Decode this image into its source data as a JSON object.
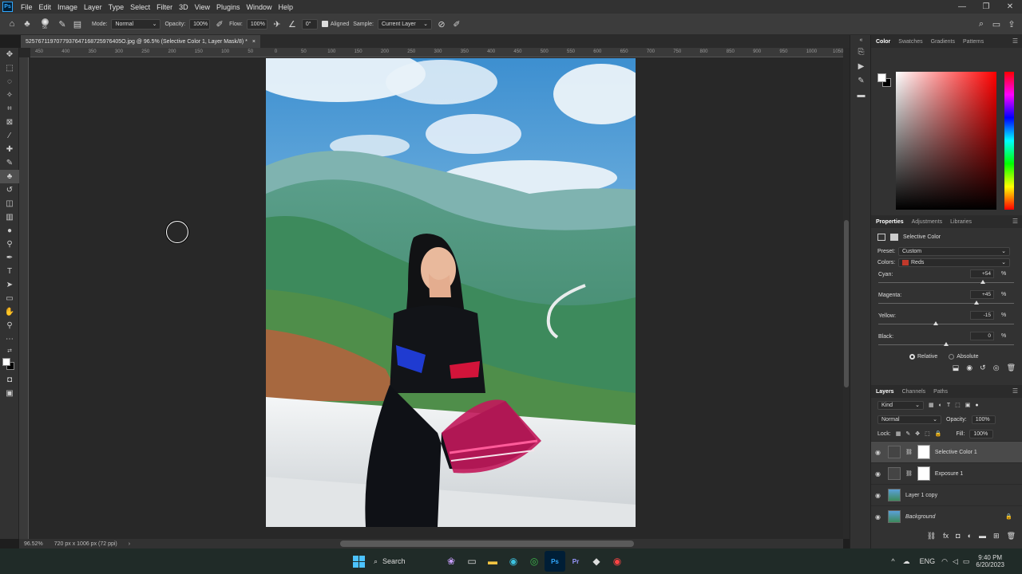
{
  "menu": {
    "logo": "Ps",
    "items": [
      "File",
      "Edit",
      "Image",
      "Layer",
      "Type",
      "Select",
      "Filter",
      "3D",
      "View",
      "Plugins",
      "Window",
      "Help"
    ]
  },
  "options_bar": {
    "brush_size": "56",
    "mode_label": "Mode:",
    "mode_value": "Normal",
    "opacity_label": "Opacity:",
    "opacity_value": "100%",
    "flow_label": "Flow:",
    "flow_value": "100%",
    "angle_value": "0°",
    "aligned_label": "Aligned",
    "sample_label": "Sample:",
    "sample_value": "Current Layer"
  },
  "document": {
    "tab_title": "5257671197077937647168725976405O.jpg @ 96.5% (Selective Color 1, Layer Mask/8) *",
    "close": "×"
  },
  "rulers": {
    "top": [
      "450",
      "400",
      "350",
      "300",
      "250",
      "200",
      "150",
      "100",
      "50",
      "0",
      "50",
      "100",
      "150",
      "200",
      "250",
      "300",
      "350",
      "400",
      "450",
      "500",
      "550",
      "600",
      "650",
      "700",
      "750",
      "800",
      "850",
      "900",
      "950",
      "1000",
      "1050"
    ]
  },
  "status": {
    "zoom": "96.52%",
    "doc_size": "720 px x 1006 px (72 ppi)",
    "arrow": "›"
  },
  "color_panel": {
    "tabs": [
      "Color",
      "Swatches",
      "Gradients",
      "Patterns"
    ],
    "active": "Color",
    "accent": "#ff0000"
  },
  "properties": {
    "tabs": [
      "Properties",
      "Adjustments",
      "Libraries"
    ],
    "title": "Selective Color",
    "preset_label": "Preset:",
    "preset_value": "Custom",
    "colors_label": "Colors:",
    "colors_value": "Reds",
    "sliders": [
      {
        "label": "Cyan:",
        "value": "+54",
        "fraction": 0.77
      },
      {
        "label": "Magenta:",
        "value": "+45",
        "fraction": 0.725
      },
      {
        "label": "Yellow:",
        "value": "-15",
        "fraction": 0.425
      },
      {
        "label": "Black:",
        "value": "0",
        "fraction": 0.5
      }
    ],
    "pct": "%",
    "relative_label": "Relative",
    "absolute_label": "Absolute"
  },
  "layers_panel": {
    "tabs": [
      "Layers",
      "Channels",
      "Paths"
    ],
    "kind_label": "Kind",
    "blend_mode": "Normal",
    "opacity_label": "Opacity:",
    "opacity_value": "100%",
    "lock_label": "Lock:",
    "fill_label": "Fill:",
    "fill_value": "100%",
    "layers": [
      {
        "name": "Selective Color 1",
        "type": "adjustment",
        "selected": true
      },
      {
        "name": "Exposure 1",
        "type": "adjustment",
        "selected": false
      },
      {
        "name": "Layer 1 copy",
        "type": "pixel",
        "selected": false
      },
      {
        "name": "Background",
        "type": "pixel",
        "selected": false,
        "italic": true
      }
    ]
  },
  "taskbar": {
    "search_label": "Search",
    "lang": "ENG",
    "time": "9:40 PM",
    "date": "6/20/2023"
  }
}
